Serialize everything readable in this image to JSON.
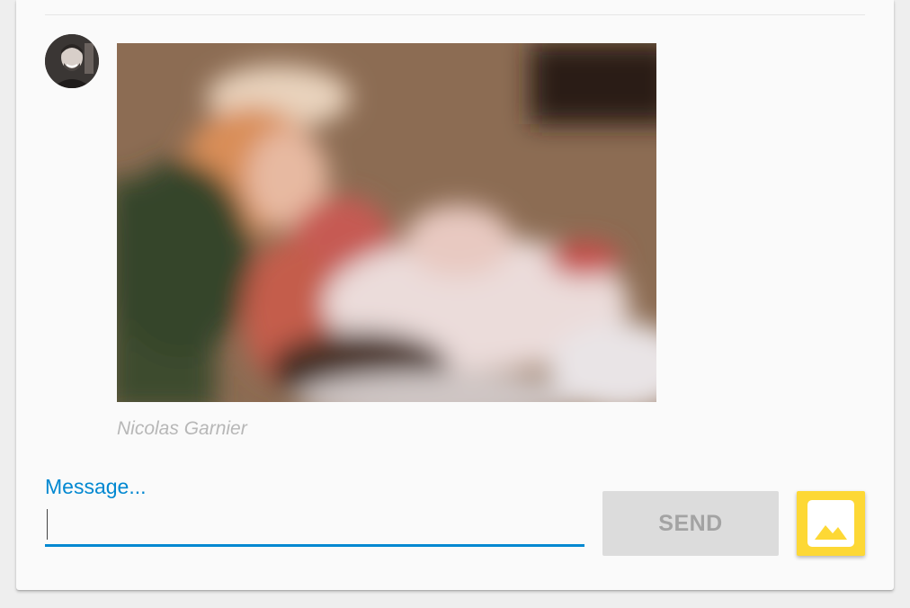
{
  "message": {
    "sender_name": "Nicolas Garnier",
    "avatar_icon": "user-avatar",
    "image_icon": "blurred-photo"
  },
  "composer": {
    "label": "Message...",
    "value": "",
    "send_label": "SEND",
    "image_button_icon": "image-icon"
  },
  "colors": {
    "accent": "#0288d1",
    "image_button": "#fdd835",
    "send_disabled_bg": "#dcdcdc",
    "send_disabled_text": "#a3a3a3"
  }
}
